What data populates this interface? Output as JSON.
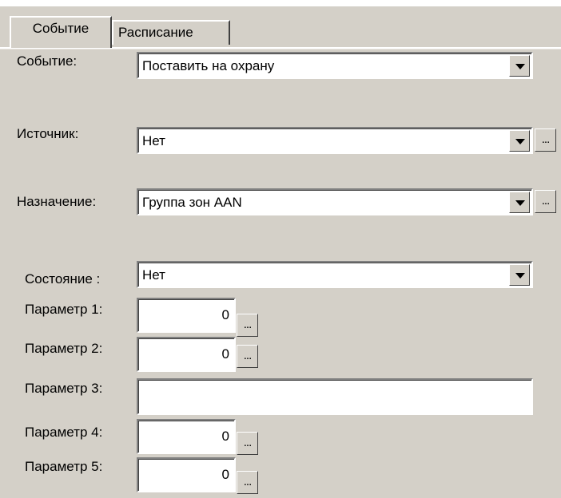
{
  "tabs": [
    {
      "label": "Событие",
      "active": true
    },
    {
      "label": "Расписание",
      "active": false
    }
  ],
  "fields": {
    "event": {
      "label": "Событие:",
      "value": "Поставить на охрану"
    },
    "source": {
      "label": "Источник:",
      "value": "Нет"
    },
    "destination": {
      "label": "Назначение:",
      "value": "Группа зон AAN"
    },
    "state": {
      "label": "Состояние :",
      "value": "Нет"
    },
    "param1": {
      "label": "Параметр 1:",
      "value": "0"
    },
    "param2": {
      "label": "Параметр 2:",
      "value": "0"
    },
    "param3": {
      "label": "Параметр 3:",
      "value": ""
    },
    "param4": {
      "label": "Параметр 4:",
      "value": "0"
    },
    "param5": {
      "label": "Параметр 5:",
      "value": "0"
    }
  },
  "browse_label": "...",
  "colors": {
    "background": "#d4d0c8",
    "field": "#ffffff"
  },
  "icons": {
    "dropdown": "chevron-down-icon"
  }
}
